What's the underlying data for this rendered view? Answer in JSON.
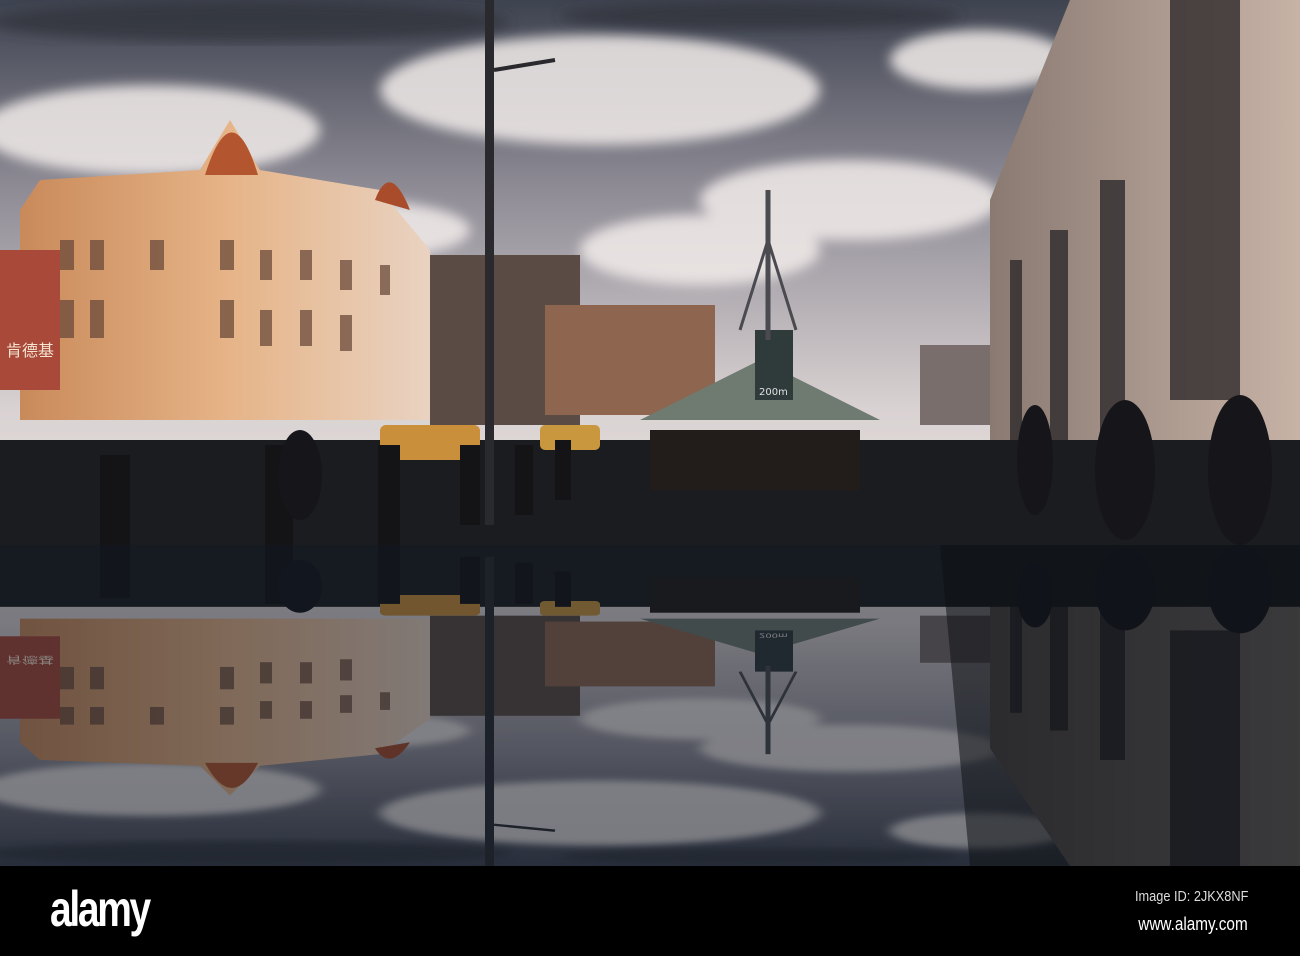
{
  "photo": {
    "subject": "rain-reflection street scene",
    "signs": {
      "kfc": "肯德基",
      "distance": "200m"
    },
    "colors": {
      "sky_top": "#4a4f5c",
      "sky_mid": "#c9c3c6",
      "building_warm": "#d59c6c",
      "water": "#1c2530"
    }
  },
  "footer": {
    "logo": "alamy",
    "image_id": "Image ID: 2JKX8NF",
    "url": "www.alamy.com"
  }
}
